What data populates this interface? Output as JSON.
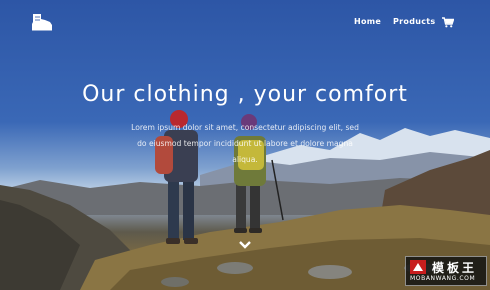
{
  "nav": {
    "logo_icon": "hiking-boot-icon",
    "links": [
      {
        "label": "Home"
      },
      {
        "label": "Products"
      }
    ],
    "cart_icon": "shopping-cart-icon"
  },
  "hero": {
    "headline": "Our clothing , your comfort",
    "lead": "Lorem ipsum dolor sit amet, consectetur adipiscing elit, sed do eiusmod tempor incididunt ut labore et dolore magna aliqua.",
    "scroll_icon": "chevron-down-icon"
  },
  "watermark": {
    "title": "模板王",
    "url": "MOBANWANG.COM"
  },
  "colors": {
    "text": "#ffffff",
    "sky": "#2d56a6"
  }
}
